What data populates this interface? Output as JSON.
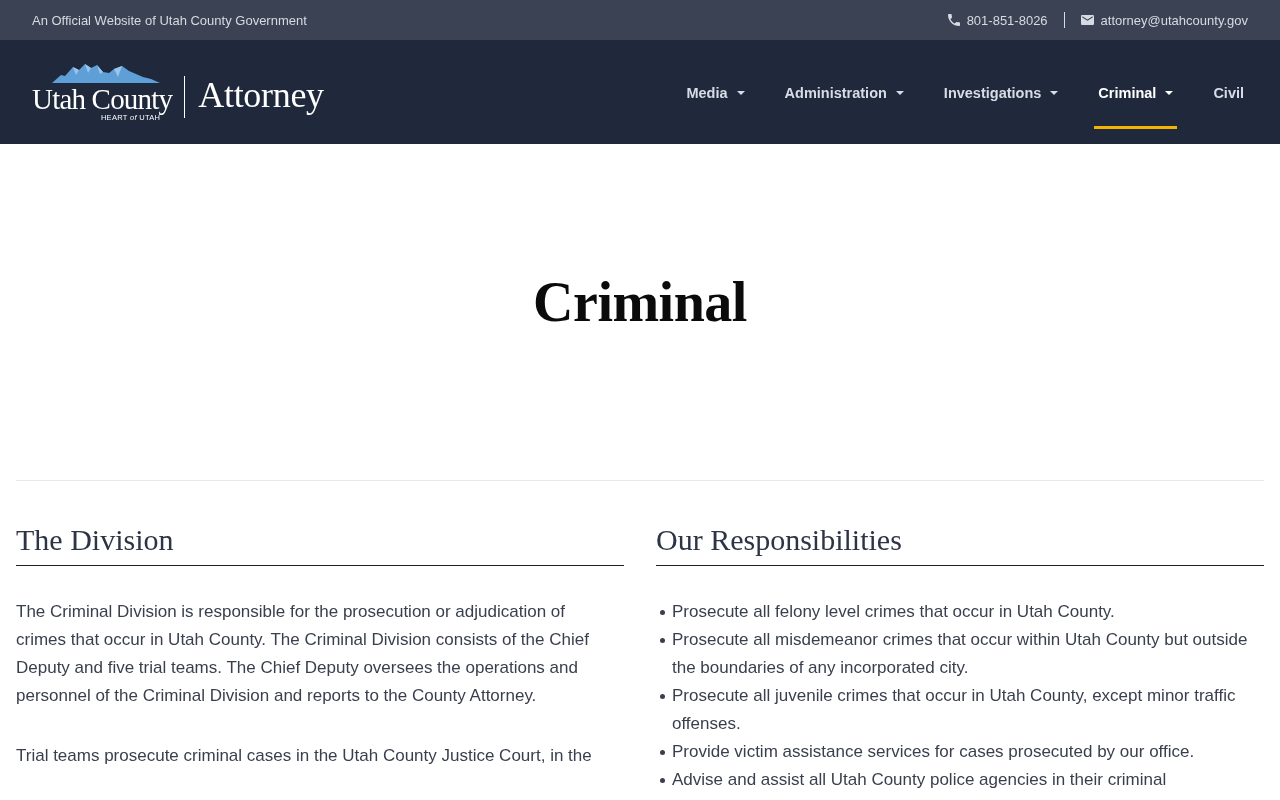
{
  "top_bar": {
    "notice": "An Official Website of Utah County Government",
    "contacts": [
      {
        "kind": "phone",
        "text": "801-851-8026"
      },
      {
        "kind": "email",
        "text": "attorney@utahcounty.gov"
      }
    ]
  },
  "header": {
    "logo": {
      "county": "Utah County",
      "tagline": "HEART *of* UTAH",
      "office": "Attorney"
    },
    "nav": [
      {
        "label": "Media",
        "dropdown": true,
        "selected": false
      },
      {
        "label": "Administration",
        "dropdown": true,
        "selected": false
      },
      {
        "label": "Investigations",
        "dropdown": true,
        "selected": false
      },
      {
        "label": "Criminal",
        "dropdown": true,
        "selected": true
      },
      {
        "label": "Civil",
        "dropdown": false,
        "selected": false
      }
    ]
  },
  "hero": {
    "title": "Criminal"
  },
  "sections": [
    {
      "heading": "The Division",
      "kind": "paragraphs",
      "items": [
        "The Criminal Division is responsible for the prosecution or adjudication of crimes that occur in Utah County. The Criminal Division consists of the Chief Deputy and five trial teams. The Chief Deputy oversees the operations and personnel of the Criminal Division and reports to the County Attorney.",
        "Trial teams prosecute criminal cases in the Utah County Justice Court, in the"
      ]
    },
    {
      "heading": "Our Responsibilities",
      "kind": "bullets",
      "items": [
        "Prosecute all felony level crimes that occur in Utah County.",
        "Prosecute all misdemeanor crimes that occur within Utah County but outside the boundaries of any incorporated city.",
        "Prosecute all juvenile crimes that occur in Utah County, except minor traffic offenses.",
        "Provide victim assistance services for cases prosecuted by our office.",
        "Advise and assist all Utah County police agencies in their criminal"
      ]
    }
  ]
}
